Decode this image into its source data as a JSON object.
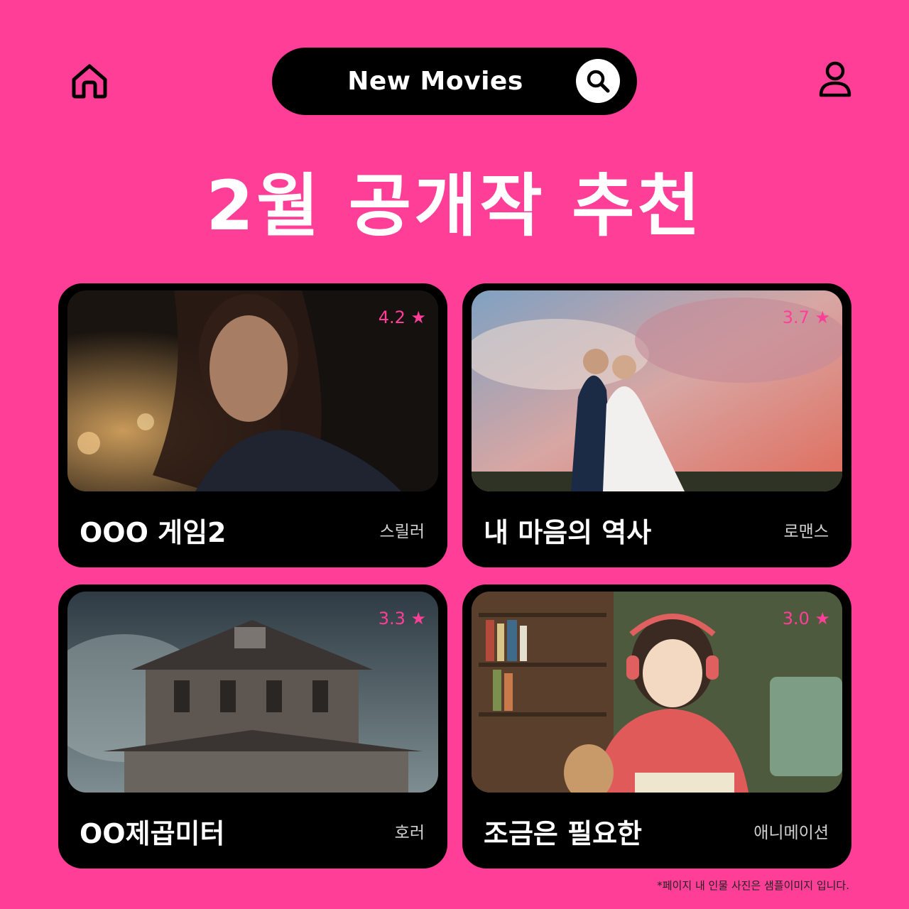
{
  "header": {
    "home_icon": "home-icon",
    "search_title": "New Movies",
    "search_icon": "search-icon",
    "profile_icon": "user-icon"
  },
  "headline": "2월 공개작 추천",
  "colors": {
    "background": "#ff3f97",
    "card": "#000000",
    "rating": "#ff3f97"
  },
  "movies": [
    {
      "title": "OOO 게임2",
      "genre": "스릴러",
      "rating": "4.2 ★"
    },
    {
      "title": "내 마음의 역사",
      "genre": "로맨스",
      "rating": "3.7 ★"
    },
    {
      "title": "OO제곱미터",
      "genre": "호러",
      "rating": "3.3 ★"
    },
    {
      "title": "조금은 필요한",
      "genre": "애니메이션",
      "rating": "3.0 ★"
    }
  ],
  "footnote": "*페이지 내 인물 사진은 샘플이미지 입니다."
}
